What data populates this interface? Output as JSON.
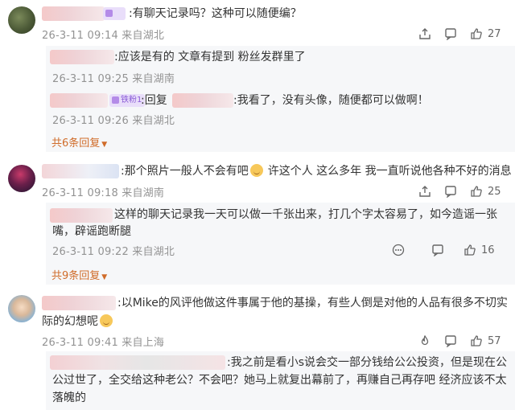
{
  "icons": {
    "share": "share-icon",
    "comment": "comment-icon",
    "like": "thumb-up-icon",
    "hot": "fire-icon"
  },
  "colors": {
    "expand": "#d06c2a",
    "meta": "#939393",
    "reply_bg": "#f6f7f9"
  },
  "comments": [
    {
      "text": ":有聊天记录吗？这种可以随便编？",
      "time": "26-3-11 09:14",
      "location": "来自湖北",
      "likes": "27",
      "replies": [
        {
          "text": ":应该是有的 文章有提到 粉丝发群里了",
          "time": "26-3-11 09:25",
          "location": "来自湖南"
        },
        {
          "badge": "铁粉1",
          "text_a": ":回复",
          "text_b": ":我看了，没有头像，随便都可以做啊！",
          "time": "26-3-11 09:26",
          "location": "来自湖北"
        }
      ],
      "expand": "共6条回复"
    },
    {
      "text_a": ":那个照片一般人不会有吧",
      "text_b": "许这个人 这么多年 我一直听说他各种不好的消息",
      "time": "26-3-11 09:18",
      "location": "来自湖南",
      "likes": "25",
      "replies": [
        {
          "line1": "这样的聊天记录我一天可以做一千张出来，打几个字太容易了，如今造谣一张",
          "line2": "嘴，辟谣跑断腿",
          "time": "26-3-11 09:22",
          "location": "来自湖北",
          "likes": "16"
        }
      ],
      "expand": "共9条回复"
    },
    {
      "line1": ":以Mike的风评他做这件事属于他的基操，有些人倒是对他的人品有很多不切实",
      "line2": "际的幻想呢",
      "time": "26-3-11 09:41",
      "location": "来自上海",
      "likes": "57",
      "replies": [
        {
          "line1": ":我之前是看小s说会交一部分钱给公公投资，但是现在公",
          "line2": "公过世了，全交给这种老公？不会吧？她马上就复出幕前了，再赚自己再存吧 经济应该不太",
          "line3": "落魄的"
        }
      ]
    }
  ]
}
